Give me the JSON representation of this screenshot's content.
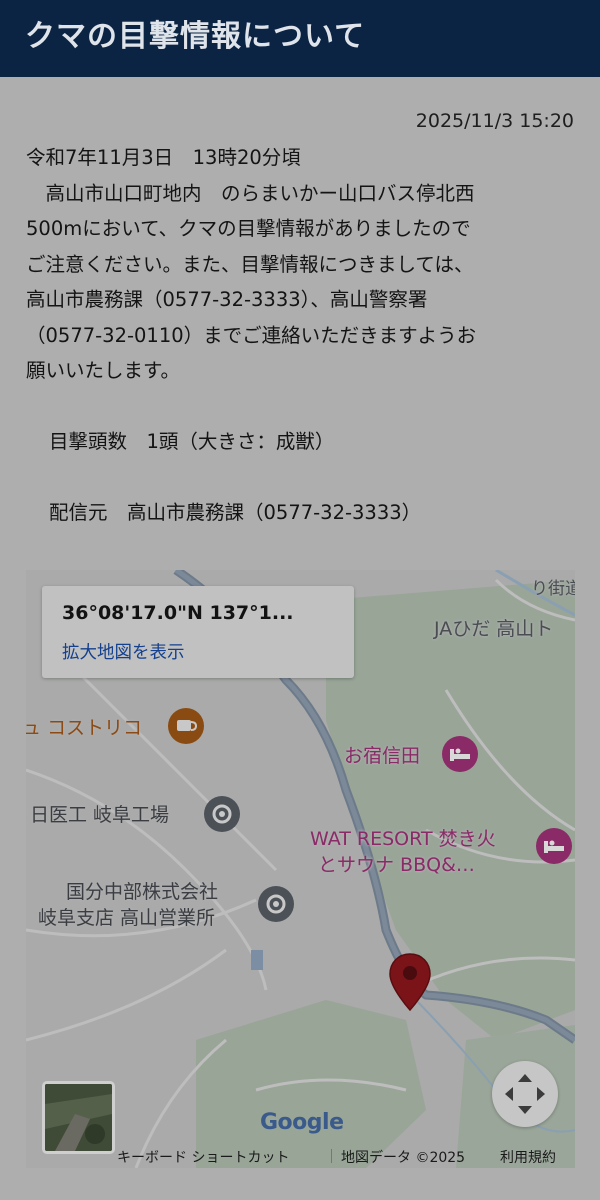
{
  "header": {
    "title": "クマの目撃情報について"
  },
  "post": {
    "timestamp": "2025/11/3 15:20",
    "lines": [
      "令和7年11月3日　13時20分頃",
      "　高山市山口町地内　のらまいかー山口バス停北西",
      "500mにおいて、クマの目撃情報がありましたので",
      "ご注意ください。また、目撃情報につきましては、",
      "高山市農務課（0577-32-3333）、高山警察署",
      "（0577-32-0110）までご連絡いただきますようお",
      "願いいたします。"
    ],
    "count_line": "目撃頭数　1頭（大きさ：成獣）",
    "source_line": "配信元　高山市農務課（0577-32-3333）"
  },
  "map": {
    "coords": "36°08'17.0\"N 137°1...",
    "enlarge_link": "拡大地図を表示",
    "places": {
      "costrico": "ュ コストリコ",
      "nichiiko": "日医工 岐阜工場",
      "kokubun_1": "国分中部株式会社",
      "kokubun_2": "岐阜支店 高山営業所",
      "ja_hida": "JAひだ 高山ト",
      "oyado": "お宿信田",
      "wat_1": "WAT RESORT 焚き火",
      "wat_2": "とサウナ BBQ&…",
      "road": "り街道"
    },
    "google_logo": "Google",
    "footer": {
      "shortcuts": "キーボード ショートカット",
      "map_data": "地図データ ©2025",
      "terms": "利用規約"
    }
  }
}
